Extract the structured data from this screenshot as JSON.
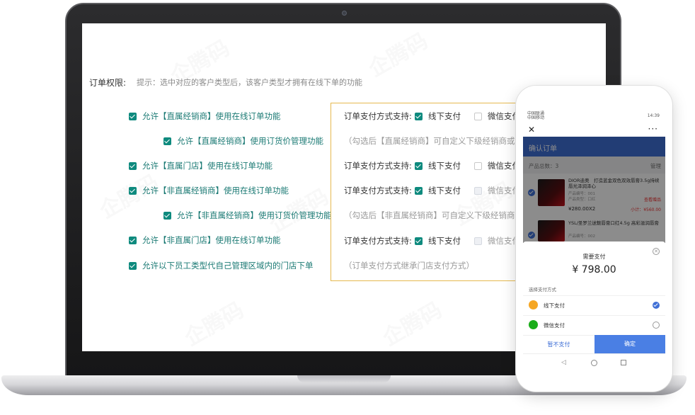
{
  "order_permission": {
    "label": "订单权限:",
    "hint": "提示：选中对应的客户类型后，该客户类型才拥有在线下单的功能",
    "options": [
      {
        "label": "允许【直属经销商】使用在线订单功能",
        "checked": true
      },
      {
        "label": "允许【直属经销商】使用订货价管理功能",
        "checked": true
      },
      {
        "label": "允许【直属门店】使用在线订单功能",
        "checked": true
      },
      {
        "label": "允许【非直属经销商】使用在线订单功能",
        "checked": true
      },
      {
        "label": "允许【非直属经销商】使用订货价管理功能",
        "checked": true
      },
      {
        "label": "允许【非直属门店】使用在线订单功能",
        "checked": true
      },
      {
        "label": "允许以下员工类型代自己管理区域内的门店下单",
        "checked": true
      }
    ]
  },
  "payment": {
    "rows": [
      {
        "label": "订单支付方式支持:",
        "offline": "线下支付",
        "wechat": "微信支付"
      },
      {
        "note": "（勾选后【直属经销商】可自定义下级经销商或直"
      },
      {
        "label": "订单支付方式支持:",
        "offline": "线下支付",
        "wechat": "微信支付"
      },
      {
        "label": "订单支付方式支持:",
        "offline": "线下支付",
        "wechat": "微信支付"
      },
      {
        "note": "（勾选后【非直属经销商】可自定义下级经销商或直"
      },
      {
        "label": "订单支付方式支持:",
        "offline": "线下支付",
        "wechat": "微信支付"
      },
      {
        "note": "（订单支付方式继承门店支付方式）"
      }
    ]
  },
  "watermark": "企腾码",
  "phone": {
    "status": {
      "carrier": "中国联通",
      "carrier2": "中国移动",
      "time": "14:39"
    },
    "page_title": "确认订单",
    "product_total": "产品总数：3",
    "manage": "管理",
    "items": [
      {
        "name": "DIOR迪奥　打造蓝金双色双效唇膏3.5g持续唇光泽润泽心",
        "code": "产品编号：001",
        "code2": "产品类型：口红",
        "price": "¥280.00X2",
        "subtotal": "小计：",
        "sub_value": "¥560.00",
        "extra": "查看赠品"
      },
      {
        "name": "YSL/圣罗兰迷魅唇膏口红4.5g 高彩滋润唇膏",
        "code": "产品编号：002"
      }
    ],
    "sheet": {
      "title": "需要支付",
      "amount": "¥ 798.00",
      "choose_label": "选择支付方式",
      "methods": [
        {
          "label": "线下支付",
          "selected": true,
          "color": "#f5a623"
        },
        {
          "label": "微信支付",
          "selected": false,
          "color": "#1aad19"
        }
      ],
      "later": "暂不支付",
      "confirm": "确定"
    },
    "nav": {
      "back": "◁"
    }
  },
  "colors": {
    "accent": "#0e8a7e",
    "border_gold": "#e6b94f",
    "phone_blue": "#3f6fd6"
  }
}
